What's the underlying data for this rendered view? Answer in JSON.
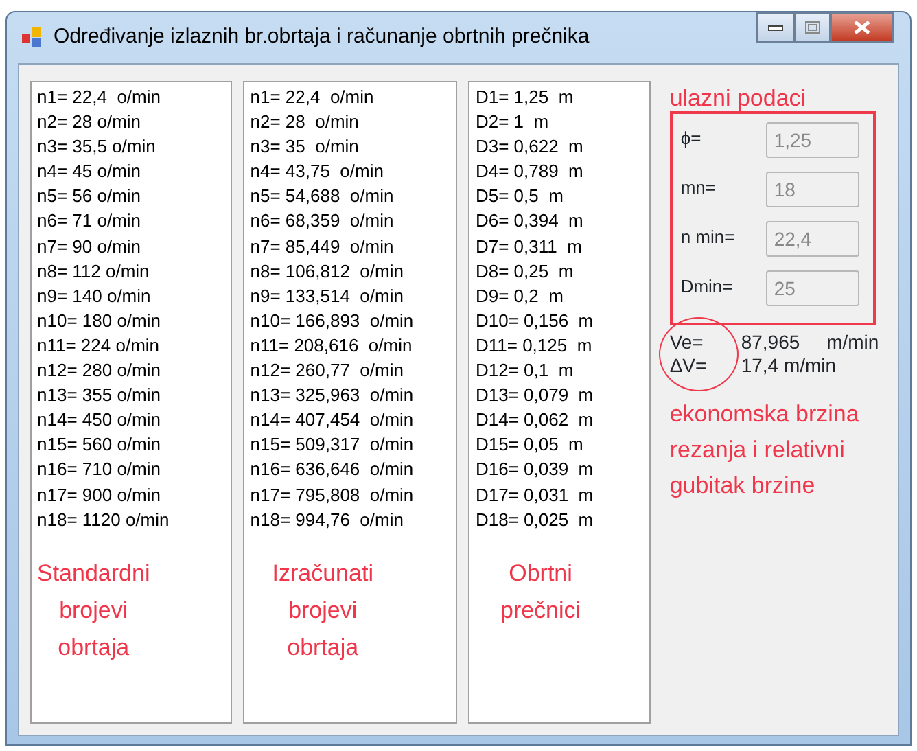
{
  "window": {
    "title": "Određivanje izlaznih br.obrtaja i računanje obrtnih prečnika"
  },
  "lists": [
    {
      "items": [
        "n1= 22,4  o/min",
        "n2= 28 o/min",
        "n3= 35,5 o/min",
        "n4= 45 o/min",
        "n5= 56 o/min",
        "n6= 71 o/min",
        "n7= 90 o/min",
        "n8= 112 o/min",
        "n9= 140 o/min",
        "n10= 180 o/min",
        "n11= 224 o/min",
        "n12= 280 o/min",
        "n13= 355 o/min",
        "n14= 450 o/min",
        "n15= 560 o/min",
        "n16= 710 o/min",
        "n17= 900 o/min",
        "n18= 1120 o/min"
      ],
      "caption": [
        "Standardni",
        "brojevi",
        "obrtaja"
      ]
    },
    {
      "items": [
        "n1= 22,4  o/min",
        "n2= 28  o/min",
        "n3= 35  o/min",
        "n4= 43,75  o/min",
        "n5= 54,688  o/min",
        "n6= 68,359  o/min",
        "n7= 85,449  o/min",
        "n8= 106,812  o/min",
        "n9= 133,514  o/min",
        "n10= 166,893  o/min",
        "n11= 208,616  o/min",
        "n12= 260,77  o/min",
        "n13= 325,963  o/min",
        "n14= 407,454  o/min",
        "n15= 509,317  o/min",
        "n16= 636,646  o/min",
        "n17= 795,808  o/min",
        "n18= 994,76  o/min"
      ],
      "caption": [
        "Izračunati",
        "brojevi",
        "obrtaja"
      ]
    },
    {
      "items": [
        "D1= 1,25  m",
        "D2= 1  m",
        "D3= 0,622  m",
        "D4= 0,789  m",
        "D5= 0,5  m",
        "D6= 0,394  m",
        "D7= 0,311  m",
        "D8= 0,25  m",
        "D9= 0,2  m",
        "D10= 0,156  m",
        "D11= 0,125  m",
        "D12= 0,1  m",
        "D13= 0,079  m",
        "D14= 0,062  m",
        "D15= 0,05  m",
        "D16= 0,039  m",
        "D17= 0,031  m",
        "D18= 0,025  m"
      ],
      "caption": [
        "Obrtni",
        "prečnici"
      ]
    }
  ],
  "inputs_note": "ulazni podaci",
  "inputs": [
    {
      "label": "ϕ=",
      "value": "1,25",
      "disabled": true
    },
    {
      "label": "mn=",
      "value": "18",
      "disabled": true
    },
    {
      "label": "n min=",
      "value": "22,4",
      "disabled": true
    },
    {
      "label": "Dmin=",
      "value": "25",
      "disabled": true
    }
  ],
  "results": [
    {
      "label": "Ve=",
      "value": "87,965",
      "unit": "m/min"
    },
    {
      "label": "ΔV=",
      "value": "17,4 m/min"
    }
  ],
  "results_note": [
    "ekonomska brzina",
    "rezanja i relativni",
    "gubitak brzine"
  ]
}
